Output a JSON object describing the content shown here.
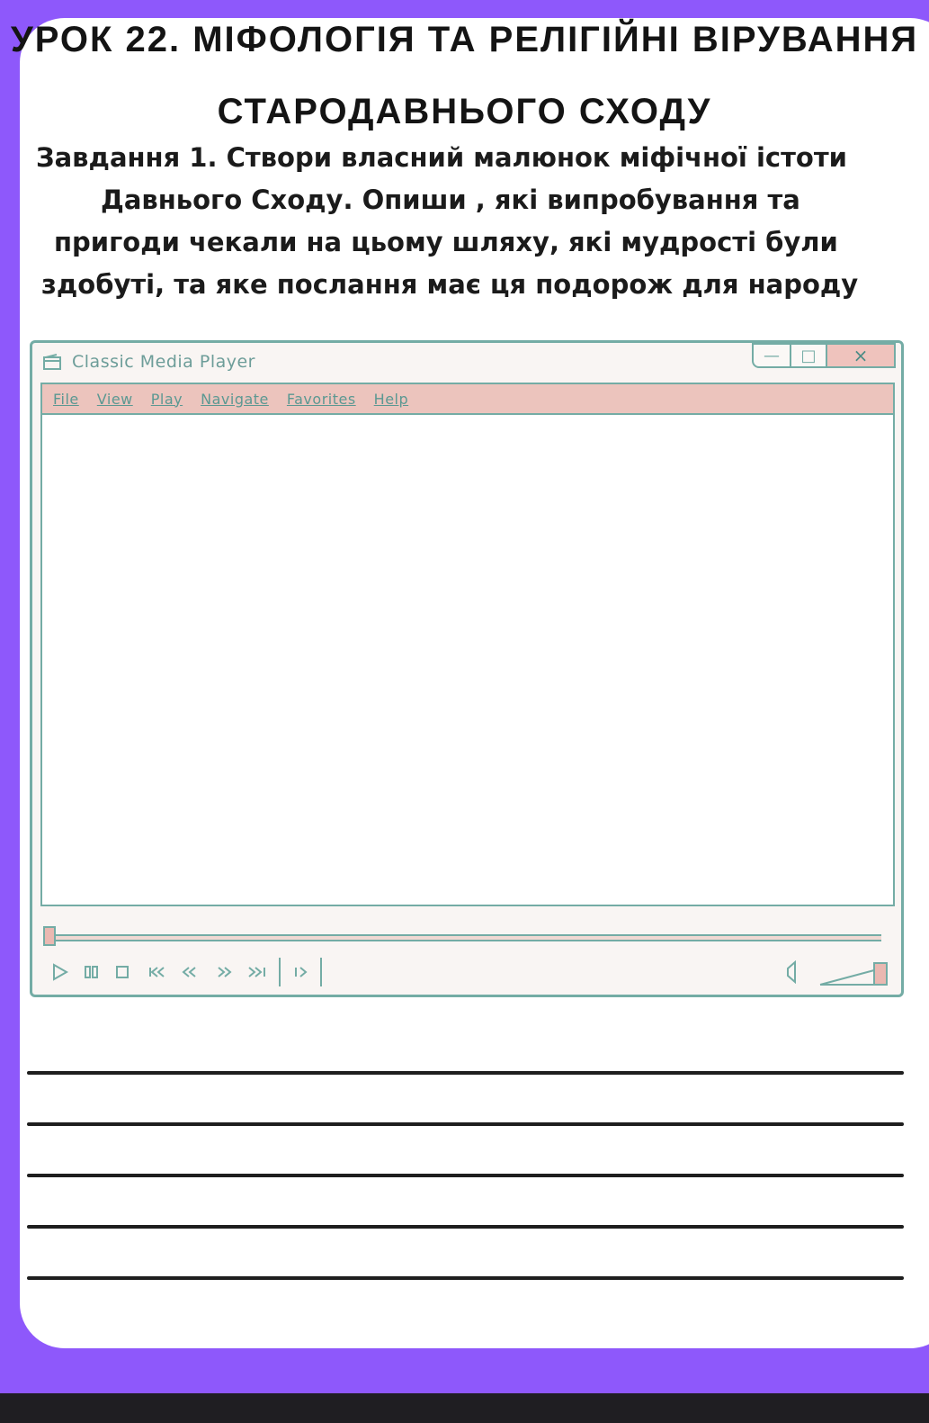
{
  "lesson": {
    "title_line1": "УРОК 22. МІФОЛОГІЯ ТА РЕЛІГІЙНІ ВІРУВАННЯ",
    "title_line2": "СТАРОДАВНЬОГО СХОДУ"
  },
  "task": {
    "lines": [
      "Завдання 1. Створи власний малюнок міфічної істоти",
      "Давнього Сходу. Опиши , які випробування та",
      "пригоди чекали на цьому шляху, які мудрості були",
      "здобуті, та яке послання має ця подорож для народу"
    ]
  },
  "player": {
    "title": "Classic Media Player",
    "window_buttons": {
      "minimize": "—",
      "maximize": "□",
      "close": "×"
    },
    "menu": [
      "File",
      "View",
      "Play",
      "Navigate",
      "Favorites",
      "Help"
    ],
    "controls": [
      "play-icon",
      "pause-icon",
      "stop-icon",
      "skip-back-icon",
      "rewind-icon",
      "fast-forward-icon",
      "skip-forward-icon",
      "frame-step-icon",
      "volume-icon",
      "volume-slider"
    ],
    "seek_position": 0
  },
  "answer_lines_count": 5,
  "colors": {
    "background": "#8e58fb",
    "accent": "#74aca5",
    "menu_bg": "#ecc4bd",
    "player_bg": "#f9f5f3"
  }
}
